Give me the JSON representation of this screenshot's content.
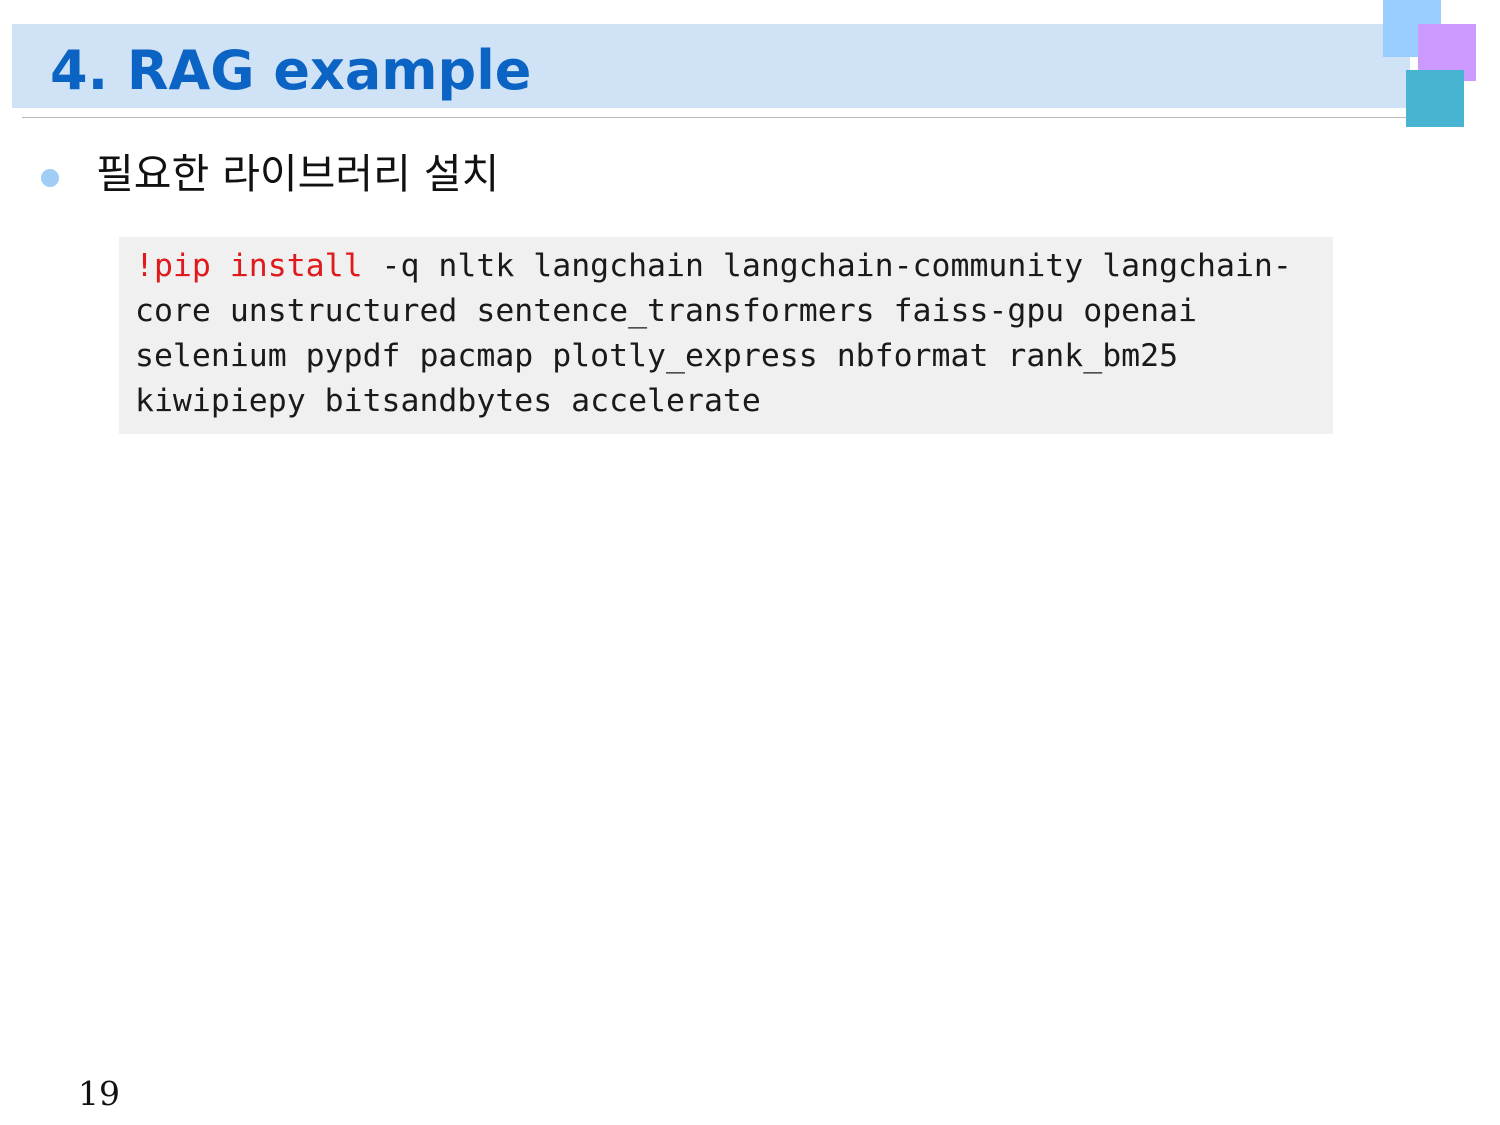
{
  "slide": {
    "title": "4. RAG example",
    "page_number": "19"
  },
  "bullets": [
    {
      "text": "필요한 라이브러리 설치"
    }
  ],
  "code": {
    "keyword_color": "#e0191c",
    "lines": [
      {
        "keyword": "!pip install",
        "rest": " -q nltk langchain langchain-community langchain-"
      },
      {
        "keyword": "",
        "rest": "core unstructured sentence_transformers faiss-gpu openai"
      },
      {
        "keyword": "",
        "rest": "selenium pypdf pacmap plotly_express nbformat rank_bm25"
      },
      {
        "keyword": "",
        "rest": "kiwipiepy bitsandbytes accelerate"
      }
    ]
  },
  "colors": {
    "title_bar": "#cfe2f6",
    "title_text": "#0b63c4",
    "bullet": "#9fcdf6",
    "code_background": "#f0f0f0",
    "deco_blue": "#99ccff",
    "deco_purple": "#cc99ff",
    "deco_teal": "#47b4d2"
  }
}
